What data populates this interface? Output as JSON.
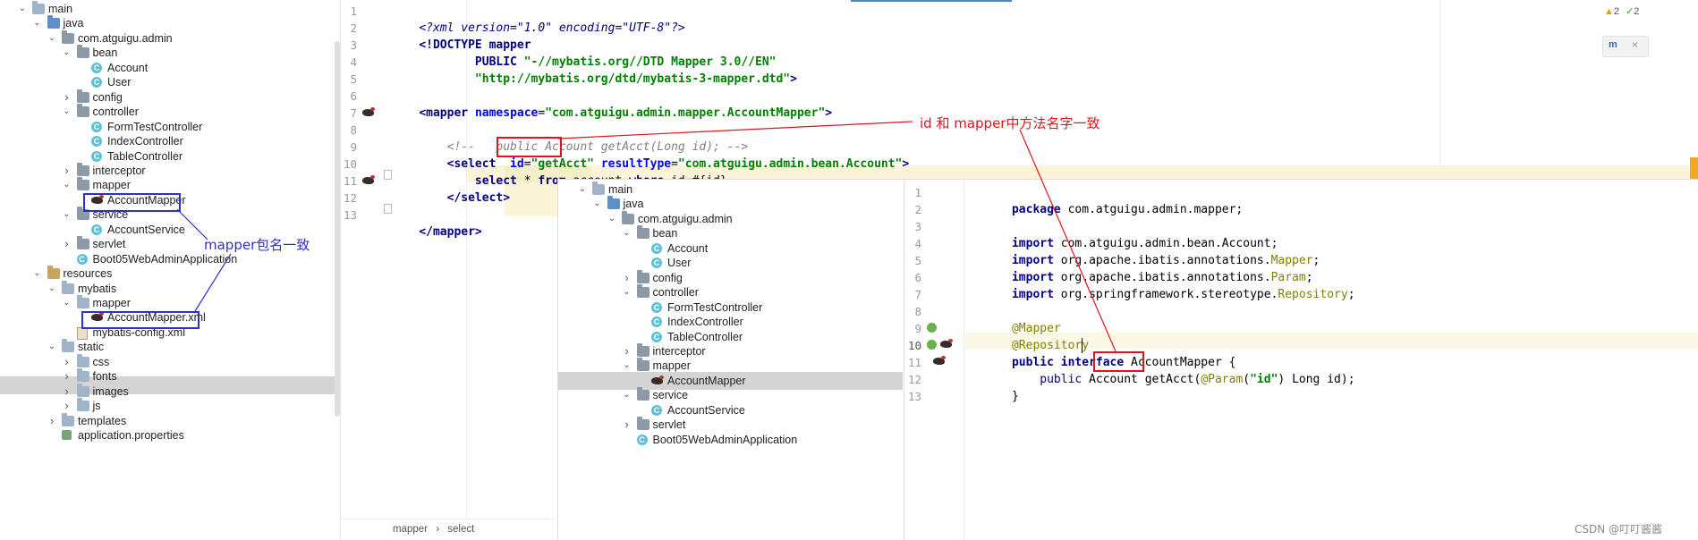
{
  "left_tree": {
    "items": [
      {
        "label": "main",
        "arrow": "down",
        "icon": "folder",
        "indent": 0
      },
      {
        "label": "java",
        "arrow": "down",
        "icon": "folder-src",
        "indent": 1
      },
      {
        "label": "com.atguigu.admin",
        "arrow": "down",
        "icon": "folder-pkg",
        "indent": 2
      },
      {
        "label": "bean",
        "arrow": "down",
        "icon": "folder-pkg",
        "indent": 3
      },
      {
        "label": "Account",
        "arrow": "",
        "icon": "class",
        "indent": 4
      },
      {
        "label": "User",
        "arrow": "",
        "icon": "class",
        "indent": 4
      },
      {
        "label": "config",
        "arrow": "right",
        "icon": "folder-pkg",
        "indent": 3
      },
      {
        "label": "controller",
        "arrow": "down",
        "icon": "folder-pkg",
        "indent": 3
      },
      {
        "label": "FormTestController",
        "arrow": "",
        "icon": "class",
        "indent": 4
      },
      {
        "label": "IndexController",
        "arrow": "",
        "icon": "class",
        "indent": 4
      },
      {
        "label": "TableController",
        "arrow": "",
        "icon": "class",
        "indent": 4
      },
      {
        "label": "interceptor",
        "arrow": "right",
        "icon": "folder-pkg",
        "indent": 3
      },
      {
        "label": "mapper",
        "arrow": "down",
        "icon": "folder-pkg",
        "indent": 3
      },
      {
        "label": "AccountMapper",
        "arrow": "",
        "icon": "mybatis",
        "indent": 4
      },
      {
        "label": "service",
        "arrow": "down",
        "icon": "folder-pkg",
        "indent": 3
      },
      {
        "label": "AccountService",
        "arrow": "",
        "icon": "class",
        "indent": 4
      },
      {
        "label": "servlet",
        "arrow": "right",
        "icon": "folder-pkg",
        "indent": 3
      },
      {
        "label": "Boot05WebAdminApplication",
        "arrow": "",
        "icon": "class",
        "indent": 3
      },
      {
        "label": "resources",
        "arrow": "down",
        "icon": "folder-res",
        "indent": 1
      },
      {
        "label": "mybatis",
        "arrow": "down",
        "icon": "folder",
        "indent": 2
      },
      {
        "label": "mapper",
        "arrow": "down",
        "icon": "folder",
        "indent": 3
      },
      {
        "label": "AccountMapper.xml",
        "arrow": "",
        "icon": "mybatis",
        "indent": 4
      },
      {
        "label": "mybatis-config.xml",
        "arrow": "",
        "icon": "xml",
        "indent": 3
      },
      {
        "label": "static",
        "arrow": "down",
        "icon": "folder",
        "indent": 2
      },
      {
        "label": "css",
        "arrow": "right",
        "icon": "folder",
        "indent": 3
      },
      {
        "label": "fonts",
        "arrow": "right",
        "icon": "folder",
        "indent": 3
      },
      {
        "label": "images",
        "arrow": "right",
        "icon": "folder",
        "indent": 3
      },
      {
        "label": "js",
        "arrow": "right",
        "icon": "folder",
        "indent": 3
      },
      {
        "label": "templates",
        "arrow": "right",
        "icon": "folder",
        "indent": 2
      },
      {
        "label": "application.properties",
        "arrow": "",
        "icon": "properties",
        "indent": 2
      }
    ]
  },
  "xml_editor": {
    "line_numbers": [
      "1",
      "2",
      "3",
      "4",
      "5",
      "6",
      "7",
      "8",
      "9",
      "10",
      "11",
      "12",
      "13"
    ],
    "lines": {
      "l1a": "<?xml version=\"1.0\" encoding=\"UTF-8\"?>",
      "l2a": "<!DOCTYPE mapper",
      "l3a": "        PUBLIC ",
      "l3b": "\"-//mybatis.org//DTD Mapper 3.0//EN\"",
      "l4a": "        \"http://mybatis.org/dtd/mybatis-3-mapper.dtd\"",
      "l4b": ">",
      "l6a": "<mapper ",
      "l6b": "namespace",
      "l6c": "=",
      "l6d": "\"com.atguigu.admin.mapper.AccountMapper\"",
      "l6e": ">",
      "l8a": "    <!--   public Account getAcct(Long id); -->",
      "l9a": "    <select",
      "l9b": "  id",
      "l9c": "=",
      "l9d": "\"getAcct\"",
      "l9e": " resultType",
      "l9f": "=",
      "l9g": "\"com.atguigu.admin.bean.Account\"",
      "l9h": ">",
      "l10a": "        select ",
      "l10b": "* ",
      "l10c": "from ",
      "l10d": "account ",
      "l10e": "where ",
      "l10f": "id=#{id}",
      "l11a": "    </select>",
      "l13a": "</mapper>"
    },
    "breadcrumb": [
      "mapper",
      "select"
    ],
    "inspection": {
      "warnings": "2",
      "ok": "2"
    }
  },
  "annotations": {
    "mapper_package_note": "mapper包名一致",
    "method_name_note": "id 和 mapper中方法名字一致"
  },
  "overlay_tree": {
    "items": [
      {
        "label": "main",
        "arrow": "down",
        "icon": "folder",
        "indent": 0
      },
      {
        "label": "java",
        "arrow": "down",
        "icon": "folder-src",
        "indent": 1
      },
      {
        "label": "com.atguigu.admin",
        "arrow": "down",
        "icon": "folder-pkg",
        "indent": 2
      },
      {
        "label": "bean",
        "arrow": "down",
        "icon": "folder-pkg",
        "indent": 3
      },
      {
        "label": "Account",
        "arrow": "",
        "icon": "class",
        "indent": 4
      },
      {
        "label": "User",
        "arrow": "",
        "icon": "class",
        "indent": 4
      },
      {
        "label": "config",
        "arrow": "right",
        "icon": "folder-pkg",
        "indent": 3
      },
      {
        "label": "controller",
        "arrow": "down",
        "icon": "folder-pkg",
        "indent": 3
      },
      {
        "label": "FormTestController",
        "arrow": "",
        "icon": "class",
        "indent": 4
      },
      {
        "label": "IndexController",
        "arrow": "",
        "icon": "class",
        "indent": 4
      },
      {
        "label": "TableController",
        "arrow": "",
        "icon": "class",
        "indent": 4
      },
      {
        "label": "interceptor",
        "arrow": "right",
        "icon": "folder-pkg",
        "indent": 3
      },
      {
        "label": "mapper",
        "arrow": "down",
        "icon": "folder-pkg",
        "indent": 3
      },
      {
        "label": "AccountMapper",
        "arrow": "",
        "icon": "mybatis",
        "indent": 4
      },
      {
        "label": "service",
        "arrow": "down",
        "icon": "folder-pkg",
        "indent": 3
      },
      {
        "label": "AccountService",
        "arrow": "",
        "icon": "class",
        "indent": 4
      },
      {
        "label": "servlet",
        "arrow": "right",
        "icon": "folder-pkg",
        "indent": 3
      },
      {
        "label": "Boot05WebAdminApplication",
        "arrow": "",
        "icon": "class",
        "indent": 3
      }
    ]
  },
  "java_editor": {
    "line_numbers": [
      "1",
      "2",
      "3",
      "4",
      "5",
      "6",
      "7",
      "8",
      "9",
      "10",
      "11",
      "12",
      "13"
    ],
    "lines": {
      "j1a": "package ",
      "j1b": "com.atguigu.admin.mapper;",
      "j3a": "import ",
      "j3b": "com.atguigu.admin.bean.Account;",
      "j4a": "import ",
      "j4b": "org.apache.ibatis.annotations.",
      "j4c": "Mapper",
      "j4d": ";",
      "j5a": "import ",
      "j5b": "org.apache.ibatis.annotations.",
      "j5c": "Param",
      "j5d": ";",
      "j6a": "import ",
      "j6b": "org.springframework.stereotype.",
      "j6c": "Repository",
      "j6d": ";",
      "j8a": "@Mapper",
      "j9a": "@Repository",
      "j10a": "public interface ",
      "j10b": "AccountMapper ",
      "j10c": "{",
      "j11a": "    public ",
      "j11b": "Account ",
      "j11c": "getAcct",
      "j11d": "(",
      "j11e": "@Param",
      "j11f": "(",
      "j11g": "\"id\"",
      "j11h": ") Long id);",
      "j12a": "}"
    }
  },
  "watermark": "CSDN @叮叮酱酱",
  "colors": {
    "xml_tag": "#000080",
    "xml_attr": "#0000ff",
    "xml_string": "#008000",
    "comment": "#808080",
    "annotation": "#808000",
    "highlight_line": "#fcf4d6",
    "selection": "#d4d4d4",
    "note_red": "#e1141b",
    "note_blue": "#3030c8"
  }
}
